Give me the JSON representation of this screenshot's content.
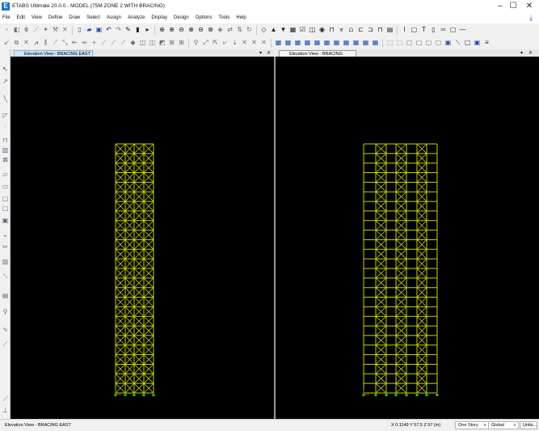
{
  "window": {
    "title": "ETABS Ultimate 20.0.0 - MODEL  (75M ZONE 2 WITH BRACING)",
    "app_icon_letter": "E",
    "controls": {
      "minimize": "–",
      "maximize": "☐",
      "close": "✕"
    }
  },
  "menu": [
    "File",
    "Edit",
    "View",
    "Define",
    "Draw",
    "Select",
    "Assign",
    "Analyze",
    "Display",
    "Design",
    "Options",
    "Tools",
    "Help"
  ],
  "panes": {
    "left": {
      "tab_label": "Elevation View - BRACING EAST",
      "menu_glyph": "▾",
      "close_glyph": "✕"
    },
    "right": {
      "tab_label": "Elevation View - BRACING NORTH",
      "menu_glyph": "▾",
      "close_glyph": "✕"
    }
  },
  "status": {
    "view_label": "Elevation View - BRACING EAST",
    "coordinates": "X 0.1149  Y 57.5  Z 97 (m)",
    "story_select": "One Story",
    "coord_system_select": "Global",
    "units_button": "Units..."
  },
  "colors": {
    "background": "#000000",
    "frame_members": "#c8d200",
    "braces": "#c8d200",
    "supports": "#22c022",
    "origin_axis_x": "#e01818"
  }
}
